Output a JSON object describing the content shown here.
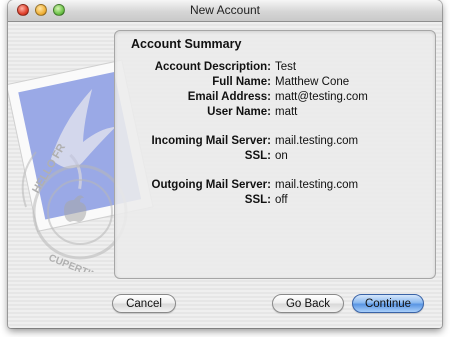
{
  "window": {
    "title": "New Account"
  },
  "summary": {
    "heading": "Account Summary",
    "rows": [
      {
        "label": "Account Description:",
        "value": "Test"
      },
      {
        "label": "Full Name:",
        "value": "Matthew Cone"
      },
      {
        "label": "Email Address:",
        "value": "matt@testing.com"
      },
      {
        "label": "User Name:",
        "value": "matt"
      },
      {
        "label": "Incoming Mail Server:",
        "value": "mail.testing.com"
      },
      {
        "label": "SSL:",
        "value": "on"
      },
      {
        "label": "Outgoing Mail Server:",
        "value": "mail.testing.com"
      },
      {
        "label": "SSL:",
        "value": "off"
      }
    ]
  },
  "stamp": {
    "postmark_top": "HELLO FR",
    "postmark_bottom": "CUPERTINO, CA"
  },
  "buttons": {
    "cancel": "Cancel",
    "go_back": "Go Back",
    "continue": "Continue"
  }
}
